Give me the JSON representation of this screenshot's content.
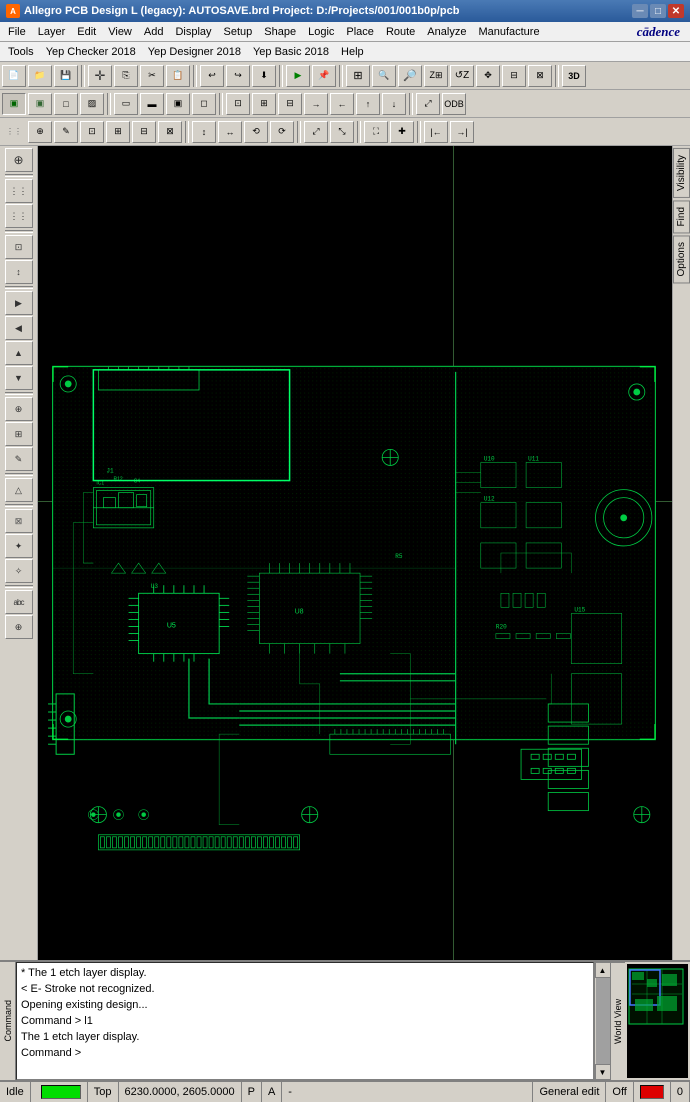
{
  "titlebar": {
    "icon": "A",
    "title": "Allegro PCB Design L (legacy): AUTOSAVE.brd  Project: D:/Projects/001/001b0p/pcb",
    "minimize": "─",
    "maximize": "□",
    "close": "✕"
  },
  "menubar1": {
    "items": [
      "File",
      "Layer",
      "Edit",
      "View",
      "Add",
      "Display",
      "Setup",
      "Shape",
      "Logic",
      "Place",
      "Route",
      "Analyze",
      "Manufacture"
    ]
  },
  "menubar2": {
    "items": [
      "Tools",
      "Yep Checker 2018",
      "Yep Designer 2018",
      "Yep Basic 2018",
      "Help"
    ]
  },
  "brand": "cādence",
  "toolbar1": {
    "buttons": [
      "📁",
      "💾",
      "⎘",
      "✂",
      "📋",
      "↩",
      "↪",
      "⬇",
      "▶",
      "📌",
      "🔍",
      "🔍",
      "🔍",
      "🔍",
      "🔍",
      "🔍",
      "🔍",
      "🔍",
      "3D"
    ]
  },
  "toolbar2": {
    "buttons": [
      "▣",
      "▣",
      "▣",
      "▣",
      "▣",
      "▣",
      "▣",
      "▣",
      "▣",
      "▣",
      "▣",
      "▣",
      "▣",
      "▣",
      "▣",
      "▣",
      "▣",
      "▣",
      "▣",
      "▣",
      "▣",
      "▣"
    ]
  },
  "toolbar3": {
    "buttons": [
      "⊕",
      "✎",
      "⊡",
      "⊞",
      "⊟",
      "⊠",
      "↕",
      "↔",
      "⟲",
      "⟳",
      "⤢",
      "⤡",
      "⛶",
      "✚"
    ]
  },
  "left_toolbar": {
    "buttons": [
      "⊕",
      "▣",
      "▣",
      "▣",
      "▣",
      "▣",
      "↕",
      "▣",
      "▣",
      "▣",
      "▣",
      "▣",
      "▣",
      "▣",
      "▣",
      "▣",
      "▣",
      "▣",
      "abc",
      "▣"
    ]
  },
  "right_tabs": [
    "Visibility",
    "Find",
    "Options"
  ],
  "console": {
    "lines": [
      "The 1 etch layer display.",
      "E- Stroke not recognized.",
      "Opening existing design...",
      "Command > l1",
      "The 1 etch layer display.",
      "Command >"
    ],
    "label": "Command"
  },
  "statusbar": {
    "idle": "Idle",
    "led_color": "#00dd00",
    "layer": "Top",
    "coordinates": "6230.0000, 2605.0000",
    "p_indicator": "P",
    "a_indicator": "A",
    "dash": "-",
    "mode": "General edit",
    "off_label": "Off",
    "err_count": "0"
  },
  "world_view": {
    "label": "World View"
  }
}
